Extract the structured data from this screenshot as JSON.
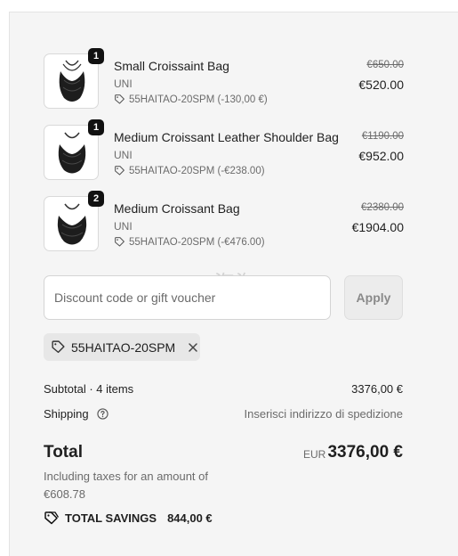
{
  "cart": {
    "items": [
      {
        "name": "Small Croissaint Bag",
        "variant": "UNI",
        "discount": "55HAITAO-20SPM (-130,00 €)",
        "original_price": "€650.00",
        "price": "€520.00",
        "quantity": "1",
        "image_icon": "croissant-bag-image"
      },
      {
        "name": "Medium Croissant Leather Shoulder Bag",
        "variant": "UNI",
        "discount": "55HAITAO-20SPM (-€238.00)",
        "original_price": "€1190.00",
        "price": "€952.00",
        "quantity": "1",
        "image_icon": "croissant-bag-image"
      },
      {
        "name": "Medium Croissant Bag",
        "variant": "UNI",
        "discount": "55HAITAO-20SPM (-€476.00)",
        "original_price": "€2380.00",
        "price": "€1904.00",
        "quantity": "2",
        "image_icon": "croissant-bag-image"
      }
    ]
  },
  "discount_form": {
    "placeholder": "Discount code or gift voucher",
    "value": "",
    "apply_label": "Apply"
  },
  "applied_code": {
    "code": "55HAITAO-20SPM",
    "tag_icon": "tag-icon",
    "remove_icon": "close-icon"
  },
  "summary": {
    "subtotal_label": "Subtotal · 4 items",
    "subtotal_value": "3376,00 €",
    "shipping_label": "Shipping",
    "shipping_value": "Inserisci indirizzo di spedizione",
    "total_label": "Total",
    "currency": "EUR",
    "total_value": "3376,00 €",
    "tax_note": "Including taxes for an amount of €608.78",
    "savings_label": "TOTAL SAVINGS",
    "savings_value": "844,00 €"
  },
  "watermark": "55海淘",
  "colors": {
    "panel_bg": "#f5f5f5",
    "text_primary": "#1f1f1f",
    "text_muted": "#6b6b6b",
    "badge_bg": "#111111",
    "chip_bg": "#e7e7e7"
  }
}
